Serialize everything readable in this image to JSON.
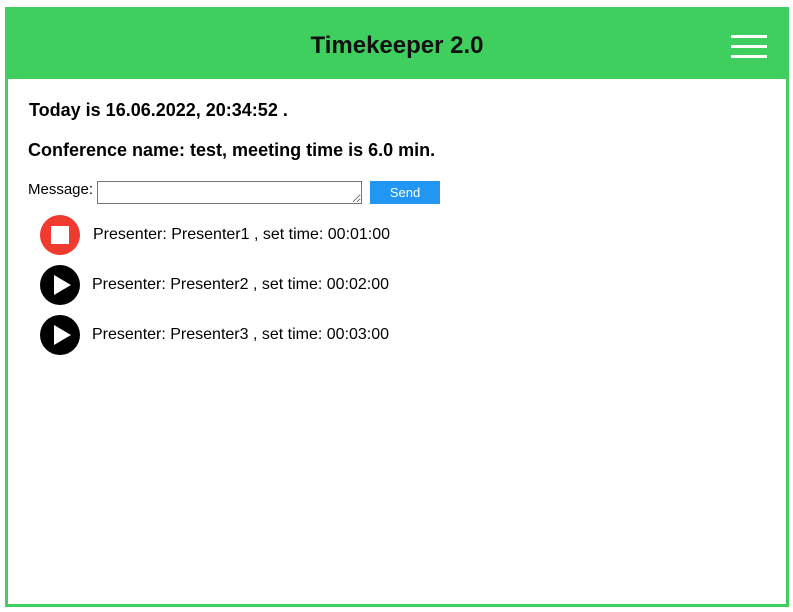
{
  "header": {
    "title": "Timekeeper 2.0",
    "menu_icon": "hamburger-menu-icon",
    "background_color": "#3fcf5e"
  },
  "today_text": "Today is 16.06.2022, 20:34:52 .",
  "conference_text": "Conference name: test, meeting time is 6.0 min.",
  "message": {
    "label": "Message:",
    "value": "",
    "send_label": "Send",
    "send_color": "#2196f3"
  },
  "presenters": [
    {
      "text": "Presenter: Presenter1 , set time: 00:01:00",
      "state": "playing",
      "icon": "stop-icon",
      "color": "#f03a30"
    },
    {
      "text": "Presenter: Presenter2 , set time: 00:02:00",
      "state": "idle",
      "icon": "play-icon",
      "color": "#000000"
    },
    {
      "text": "Presenter: Presenter3 , set time: 00:03:00",
      "state": "idle",
      "icon": "play-icon",
      "color": "#000000"
    }
  ]
}
